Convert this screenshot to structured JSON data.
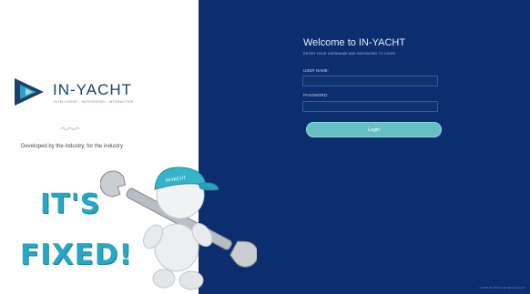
{
  "brand": {
    "name": "IN-YACHT",
    "tagline_small": "INTELLIGENT - INTEGRATED - INTERACTIVE",
    "developed_by": "Developed by the industry, for the industry"
  },
  "login": {
    "title": "Welcome to IN-YACHT",
    "subtitle": "ENTER YOUR USERNAME AND PASSWORD TO LOGIN",
    "username_label": "USER NAME:",
    "username_value": "",
    "password_label": "PASSWORD:",
    "password_value": "",
    "button_label": "Login"
  },
  "footer": {
    "copyright": "© 2020 IN-YACHT. All rights reserved"
  },
  "overlay": {
    "line1": "IT'S",
    "line2": "FIXED!",
    "cap_text": "IN-YACHT"
  },
  "colors": {
    "panel_bg": "#0c2d6e",
    "accent_teal": "#67bfc6",
    "overlay_text": "#26a7c4",
    "brand_navy": "#1d3f6e"
  },
  "icons": {
    "logo": "in-yacht-logo-icon",
    "divider": "wave-divider-icon",
    "mascot": "mascot-with-wrench-icon"
  }
}
